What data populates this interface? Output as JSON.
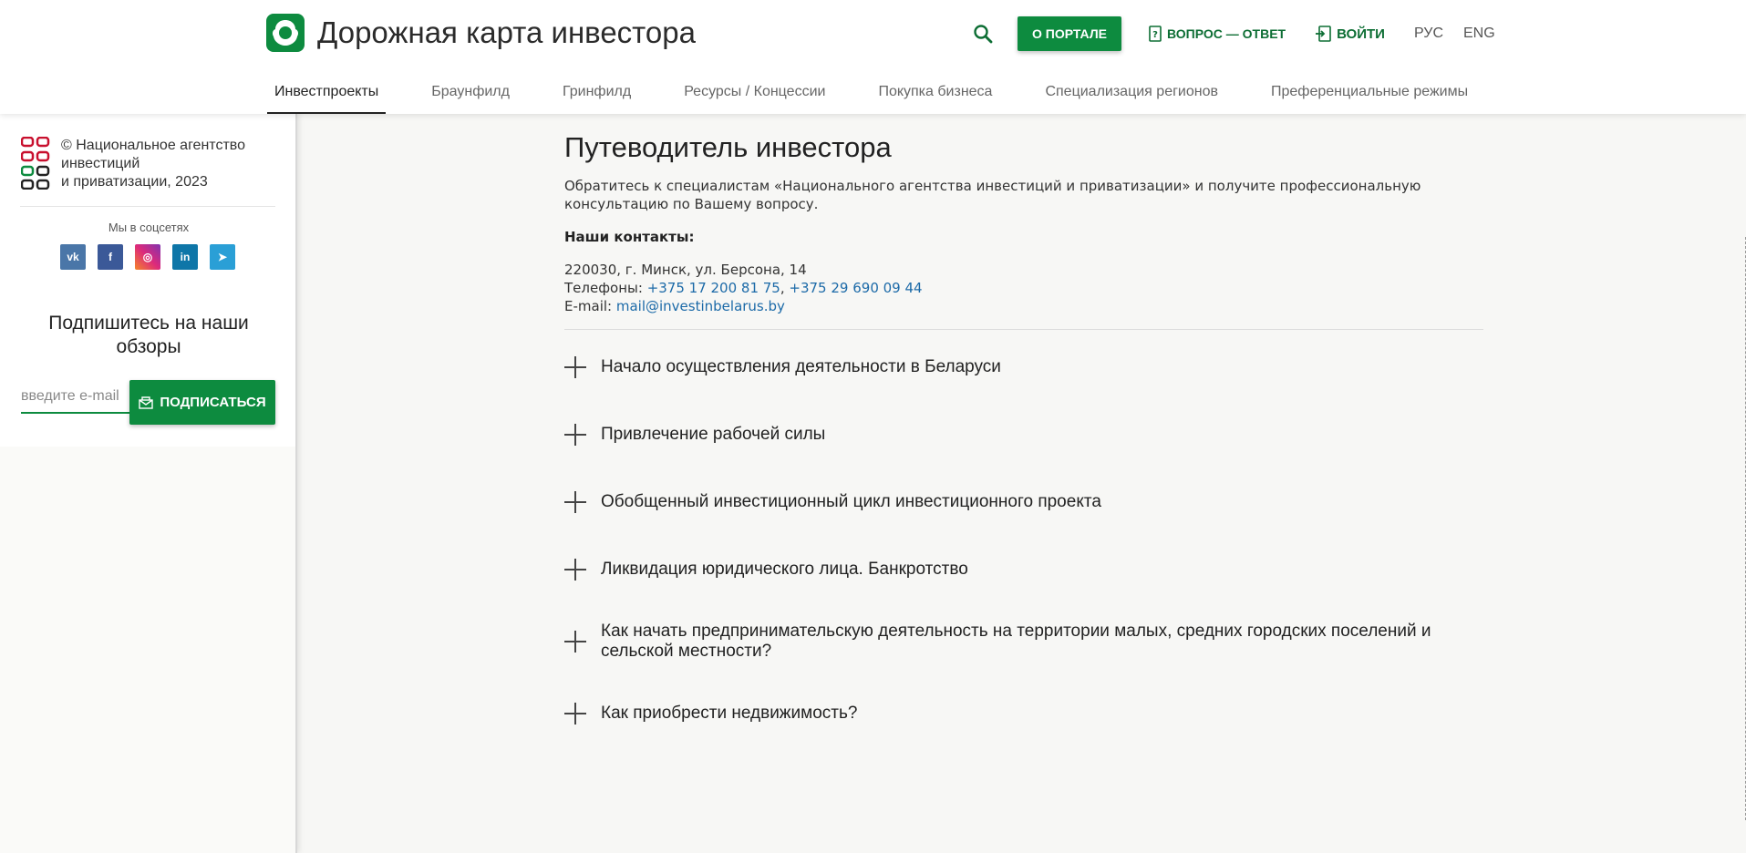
{
  "header": {
    "site_title": "Дорожная карта инвестора",
    "about_button": "О ПОРТАЛЕ",
    "qa_link": "ВОПРОС — ОТВЕТ",
    "login_link": "ВОЙТИ",
    "lang_ru": "РУС",
    "lang_en": "ENG",
    "brand_color": "#0d8b3f"
  },
  "nav": {
    "items": [
      {
        "label": "Инвестпроекты",
        "active": true
      },
      {
        "label": "Браунфилд"
      },
      {
        "label": "Гринфилд"
      },
      {
        "label": "Ресурсы / Концессии"
      },
      {
        "label": "Покупка бизнеса"
      },
      {
        "label": "Специализация регионов"
      },
      {
        "label": "Преференциальные режимы"
      }
    ]
  },
  "sidebar": {
    "agency_line1": "© Национальное агентство инвестиций",
    "agency_line2": "и приватизации, 2023",
    "social_title": "Мы в соцсетях",
    "social": [
      {
        "icon": "vk-icon",
        "glyph": "vk",
        "color": "#4a76a8"
      },
      {
        "icon": "facebook-icon",
        "glyph": "f",
        "color": "#3b5998"
      },
      {
        "icon": "instagram-icon",
        "glyph": "◎",
        "color": "#c13584"
      },
      {
        "icon": "linkedin-icon",
        "glyph": "in",
        "color": "#0e76a8"
      },
      {
        "icon": "telegram-icon",
        "glyph": "➤",
        "color": "#2a9fd6"
      }
    ],
    "subscribe_title": "Подпишитесь на наши обзоры",
    "email_placeholder": "введите e-mail",
    "subscribe_button": "ПОДПИСАТЬСЯ"
  },
  "main": {
    "title": "Путеводитель инвестора",
    "intro": "Обратитесь к специалистам «Национального агентства инвестиций и приватизации» и получите профессиональную консультацию по Вашему вопросу.",
    "contacts_heading": "Наши контакты:",
    "address": "220030, г. Минск, ул. Берсона, 14",
    "phones_label": "Телефоны: ",
    "phone1": "+375 17 200 81 75",
    "phone_sep": ", ",
    "phone2": "+375 29 690 09 44",
    "email_label": "E-mail: ",
    "email": "mail@investinbelarus.by",
    "accordion": [
      "Начало осуществления деятельности в Беларуси",
      "Привлечение рабочей силы",
      "Обобщенный инвестиционный цикл инвестиционного проекта",
      "Ликвидация юридического лица. Банкротство",
      "Как начать предпринимательскую деятельность на территории малых, средних городских поселений и сельской местности?",
      "Как приобрести недвижимость?"
    ]
  }
}
